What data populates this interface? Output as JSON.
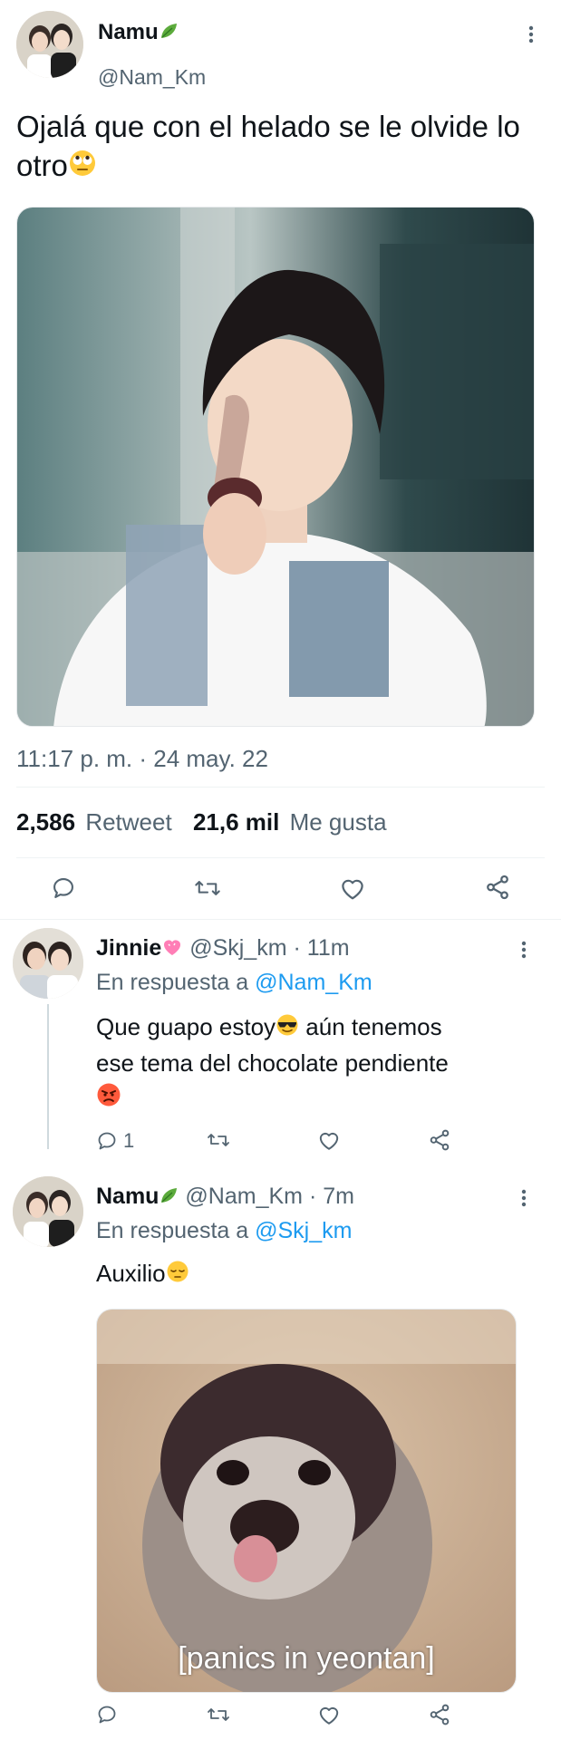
{
  "main_tweet": {
    "display_name": "Namu",
    "handle": "@Nam_Km",
    "text": "Ojalá que con el helado se le olvide lo otro",
    "timestamp": "11:17 p. m. · 24 may. 22",
    "retweet_count": "2,586",
    "retweet_label": "Retweet",
    "like_count": "21,6 mil",
    "like_label": "Me gusta"
  },
  "replies": [
    {
      "display_name": "Jinnie",
      "handle": "@Skj_km",
      "time": "· 11m",
      "reply_prefix": "En respuesta a",
      "reply_to": "@Nam_Km",
      "text_line1": "Que guapo estoy",
      "text_line1_rest": " aún tenemos",
      "text_line2": "ese tema del chocolate pendiente",
      "reply_count": "1"
    },
    {
      "display_name": "Namu",
      "handle": "@Nam_Km",
      "time": "· 7m",
      "reply_prefix": "En respuesta a",
      "reply_to": "@Skj_km",
      "text": "Auxilio",
      "media_caption": "[panics in yeontan]"
    }
  ],
  "icons": {
    "leaf": "leaf-emoji-icon",
    "eyeroll": "face-rolling-eyes-icon",
    "heart": "pink-heart-emoji-icon",
    "sunglasses": "smiling-face-sunglasses-icon",
    "angry": "angry-face-icon",
    "pensive": "pensive-face-icon",
    "reply": "reply-icon",
    "retweet": "retweet-icon",
    "like": "heart-outline-icon",
    "share": "share-icon",
    "more": "more-vertical-icon"
  },
  "colors": {
    "text": "#0f1419",
    "secondary": "#536471",
    "link": "#1d9bf0",
    "border": "#eff3f4"
  }
}
